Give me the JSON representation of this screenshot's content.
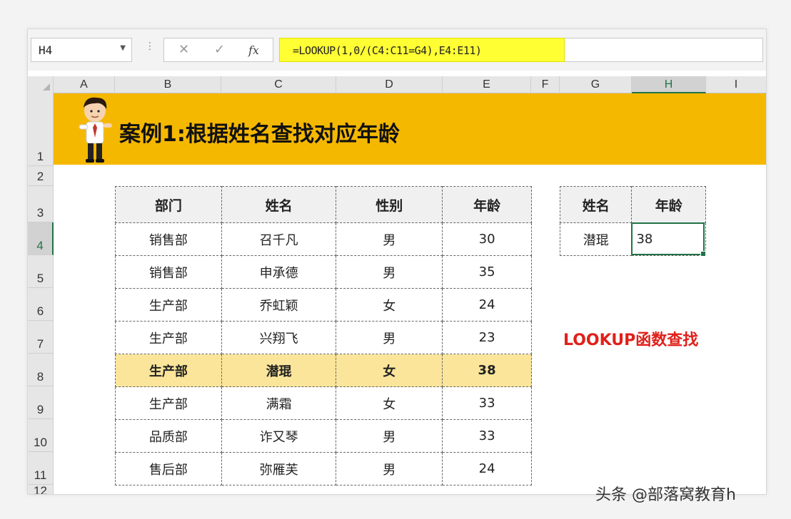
{
  "formula_bar": {
    "name_box": "H4",
    "menu_dots": "⋮",
    "cancel_symbol": "✕",
    "enter_symbol": "✓",
    "fx_symbol": "fx",
    "formula": "=LOOKUP(1,0/(C4:C11=G4),E4:E11)"
  },
  "columns": [
    "A",
    "B",
    "C",
    "D",
    "E",
    "F",
    "G",
    "H",
    "I"
  ],
  "rows": [
    "1",
    "2",
    "3",
    "4",
    "5",
    "6",
    "7",
    "8",
    "9",
    "10",
    "11",
    "12"
  ],
  "banner": {
    "title": "案例1:根据姓名查找对应年龄"
  },
  "main_table": {
    "headers": [
      "部门",
      "姓名",
      "性别",
      "年龄"
    ],
    "rows": [
      [
        "销售部",
        "召千凡",
        "男",
        "30"
      ],
      [
        "销售部",
        "申承德",
        "男",
        "35"
      ],
      [
        "生产部",
        "乔虹颖",
        "女",
        "24"
      ],
      [
        "生产部",
        "兴翔飞",
        "男",
        "23"
      ],
      [
        "生产部",
        "潜琨",
        "女",
        "38"
      ],
      [
        "生产部",
        "满霜",
        "女",
        "33"
      ],
      [
        "品质部",
        "诈又琴",
        "男",
        "33"
      ],
      [
        "售后部",
        "弥雁芙",
        "男",
        "24"
      ]
    ],
    "highlight_row_index": 4,
    "highlight_color": "#fbe59a"
  },
  "lookup_table": {
    "headers": [
      "姓名",
      "年龄"
    ],
    "name_value": "潜琨",
    "result_value": "38"
  },
  "note": "LOOKUP函数查找",
  "watermark": "头条 @部落窝教育h",
  "colors": {
    "banner": "#f5b800",
    "formula_highlight": "#ffff33",
    "note": "#e0201a",
    "selection": "#217346"
  }
}
